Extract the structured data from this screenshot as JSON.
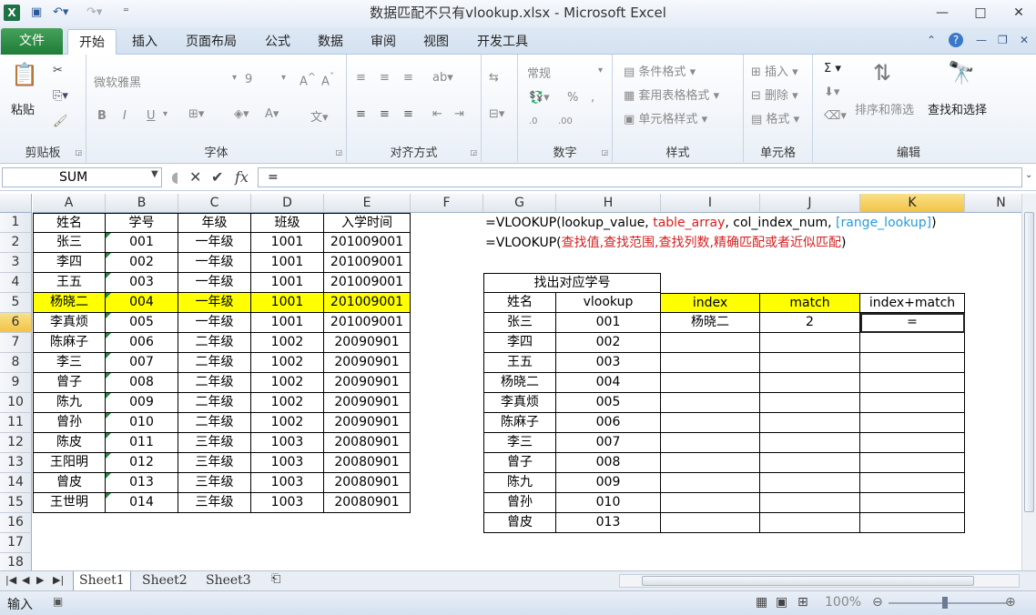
{
  "window": {
    "title": "数据匹配不只有vlookup.xlsx - Microsoft Excel",
    "app_logo": "X",
    "minimize": "—",
    "restore": "□",
    "close": "✕"
  },
  "qat": {
    "save_icon": "save-icon",
    "undo_icon": "undo-icon",
    "redo_icon": "redo-icon"
  },
  "ribbon_tabs": [
    "文件",
    "开始",
    "插入",
    "页面布局",
    "公式",
    "数据",
    "审阅",
    "视图",
    "开发工具"
  ],
  "ribbon": {
    "clipboard": {
      "label": "剪贴板",
      "paste": "粘贴"
    },
    "font": {
      "label": "字体",
      "font_name": "微软雅黑",
      "font_size": "9",
      "bold": "B",
      "italic": "I",
      "underline": "U"
    },
    "alignment": {
      "label": "对齐方式"
    },
    "number": {
      "label": "数字",
      "format": "常规"
    },
    "styles": {
      "label": "样式",
      "conditional": "条件格式",
      "table": "套用表格格式",
      "cell_styles": "单元格样式"
    },
    "cells": {
      "label": "单元格",
      "insert": "插入",
      "delete": "删除",
      "format": "格式"
    },
    "editing": {
      "label": "编辑",
      "sort_filter": "排序和筛选",
      "find_select": "查找和选择"
    }
  },
  "formula_bar": {
    "name_box": "SUM",
    "fx_label": "fx",
    "formula": "="
  },
  "columns": [
    "A",
    "B",
    "C",
    "D",
    "E",
    "F",
    "G",
    "H",
    "I",
    "J",
    "K",
    "N"
  ],
  "selected_column": "K",
  "rows": [
    "1",
    "2",
    "3",
    "4",
    "5",
    "6",
    "7",
    "8",
    "9",
    "10",
    "11",
    "12",
    "13",
    "14",
    "15",
    "16",
    "17",
    "18"
  ],
  "selected_row": "6",
  "left_table": {
    "headers": [
      "姓名",
      "学号",
      "年级",
      "班级",
      "入学时间"
    ],
    "highlight_row": 3,
    "rows": [
      [
        "张三",
        "001",
        "一年级",
        "1001",
        "201009001"
      ],
      [
        "李四",
        "002",
        "一年级",
        "1001",
        "201009001"
      ],
      [
        "王五",
        "003",
        "一年级",
        "1001",
        "201009001"
      ],
      [
        "杨晓二",
        "004",
        "一年级",
        "1001",
        "201009001"
      ],
      [
        "李真烦",
        "005",
        "一年级",
        "1001",
        "201009001"
      ],
      [
        "陈麻子",
        "006",
        "二年级",
        "1002",
        "20090901"
      ],
      [
        "李三",
        "007",
        "二年级",
        "1002",
        "20090901"
      ],
      [
        "曾子",
        "008",
        "二年级",
        "1002",
        "20090901"
      ],
      [
        "陈九",
        "009",
        "二年级",
        "1002",
        "20090901"
      ],
      [
        "曾孙",
        "010",
        "二年级",
        "1002",
        "20090901"
      ],
      [
        "陈皮",
        "011",
        "三年级",
        "1003",
        "20080901"
      ],
      [
        "王阳明",
        "012",
        "三年级",
        "1003",
        "20080901"
      ],
      [
        "曾皮",
        "013",
        "三年级",
        "1003",
        "20080901"
      ],
      [
        "王世明",
        "014",
        "三年级",
        "1003",
        "20080901"
      ]
    ]
  },
  "notes": {
    "line1": {
      "prefix": "=VLOOKUP(lookup_value, ",
      "arg2": "table_array",
      "sep": ", col_index_num, ",
      "arg4": "[range_lookup]",
      "suffix": ")"
    },
    "line2": {
      "prefix": "=VLOOKUP(",
      "args": "查找值,查找范围,查找列数,精确匹配或者近似匹配",
      "suffix": ")"
    }
  },
  "right_table": {
    "title": "找出对应学号",
    "headers": [
      "姓名",
      "vlookup",
      "index",
      "match",
      "index+match"
    ],
    "rows": [
      [
        "张三",
        "001",
        "杨晓二",
        "2",
        "="
      ],
      [
        "李四",
        "002",
        "",
        "",
        ""
      ],
      [
        "王五",
        "003",
        "",
        "",
        ""
      ],
      [
        "杨晓二",
        "004",
        "",
        "",
        ""
      ],
      [
        "李真烦",
        "005",
        "",
        "",
        ""
      ],
      [
        "陈麻子",
        "006",
        "",
        "",
        ""
      ],
      [
        "李三",
        "007",
        "",
        "",
        ""
      ],
      [
        "曾子",
        "008",
        "",
        "",
        ""
      ],
      [
        "陈九",
        "009",
        "",
        "",
        ""
      ],
      [
        "曾孙",
        "010",
        "",
        "",
        ""
      ],
      [
        "曾皮",
        "013",
        "",
        "",
        ""
      ]
    ]
  },
  "sheets": [
    "Sheet1",
    "Sheet2",
    "Sheet3"
  ],
  "active_sheet": "Sheet1",
  "status": {
    "mode": "输入",
    "zoom": "100%"
  },
  "colors": {
    "accent_green": "#1e7d38",
    "highlight": "#ffff00",
    "selection": "#f2c345",
    "note_red": "#d42020",
    "note_blue": "#2b9ad8"
  }
}
